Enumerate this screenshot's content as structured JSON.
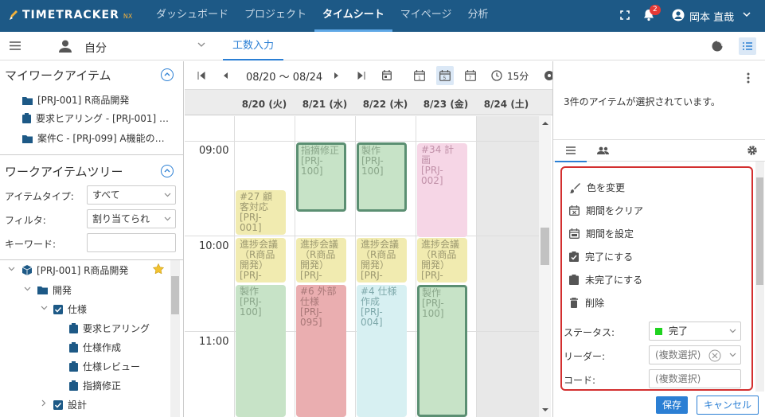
{
  "app": {
    "brand": "TIMETRACKER",
    "brand_suffix": "NX"
  },
  "nav": [
    {
      "label": "ダッシュボード",
      "active": false
    },
    {
      "label": "プロジェクト",
      "active": false
    },
    {
      "label": "タイムシート",
      "active": true
    },
    {
      "label": "マイページ",
      "active": false
    },
    {
      "label": "分析",
      "active": false
    }
  ],
  "header": {
    "notification_count": "2",
    "user_name": "岡本 直哉"
  },
  "subbar": {
    "user_select": "自分",
    "tab_label": "工数入力"
  },
  "left": {
    "my_items_title": "マイワークアイテム",
    "my_items": [
      {
        "label": "[PRJ-001] R商品開発",
        "icon": "folder-icon"
      },
      {
        "label": "要求ヒアリング - [PRJ-001] …",
        "icon": "clipboard-icon"
      },
      {
        "label": "案件C - [PRJ-099] A機能の…",
        "icon": "folder-icon"
      }
    ],
    "tree_title": "ワークアイテムツリー",
    "filters": {
      "type_label": "アイテムタイプ:",
      "type_value": "すべて",
      "filter_label": "フィルタ:",
      "filter_value": "割り当てられ",
      "keyword_label": "キーワード:",
      "keyword_value": ""
    },
    "tree": [
      {
        "label": "[PRJ-001] R商品開発",
        "icon": "cube-icon"
      },
      {
        "label": "開発",
        "icon": "folder-icon"
      },
      {
        "label": "仕様",
        "icon": "checkbox-icon"
      },
      {
        "label": "要求ヒアリング",
        "icon": "clipboard-icon"
      },
      {
        "label": "仕様作成",
        "icon": "clipboard-icon"
      },
      {
        "label": "仕様レビュー",
        "icon": "clipboard-icon"
      },
      {
        "label": "指摘修正",
        "icon": "clipboard-icon"
      },
      {
        "label": "設計",
        "icon": "checkbox-icon"
      }
    ]
  },
  "calendar": {
    "range": "08/20 ～ 08/24",
    "interval": "15分",
    "days": [
      "8/20 (火)",
      "8/21 (水)",
      "8/22 (木)",
      "8/23 (金)",
      "8/24 (土)"
    ],
    "times": [
      "09:00",
      "10:00",
      "11:00"
    ],
    "events": [
      {
        "day": 1,
        "color": "green",
        "selected": true,
        "text": "指摘修正\n[PRJ-\n100]"
      },
      {
        "day": 2,
        "color": "green",
        "selected": true,
        "text": "製作\n[PRJ-\n100]"
      },
      {
        "day": 3,
        "color": "pink",
        "selected": false,
        "text": "#34 計\n画\n[PRJ-\n002]"
      },
      {
        "day": 0,
        "color": "yellow",
        "selected": false,
        "text": "#27 顧\n客対応\n[PRJ-\n001]"
      },
      {
        "day": 0,
        "color": "yellow",
        "selected": false,
        "text": "進捗会議\n（R商品\n開発）\n[PRJ-"
      },
      {
        "day": 1,
        "color": "yellow",
        "selected": false,
        "text": "進捗会議\n（R商品\n開発）\n[PRJ-"
      },
      {
        "day": 2,
        "color": "yellow",
        "selected": false,
        "text": "進捗会議\n（R商品\n開発）\n[PRJ-"
      },
      {
        "day": 3,
        "color": "yellow",
        "selected": false,
        "text": "進捗会議\n（R商品\n開発）\n[PRJ-"
      },
      {
        "day": 0,
        "color": "green",
        "selected": false,
        "text": "製作\n[PRJ-\n100]"
      },
      {
        "day": 1,
        "color": "red",
        "selected": false,
        "text": "#6 外部\n仕様\n[PRJ-\n095]"
      },
      {
        "day": 2,
        "color": "cyan",
        "selected": false,
        "text": "#4 仕様\n作成\n[PRJ-\n004]"
      },
      {
        "day": 3,
        "color": "green",
        "selected": true,
        "text": "製作\n[PRJ-\n100]"
      }
    ]
  },
  "right": {
    "selection_text": "3件のアイテムが選択されています。",
    "actions": [
      {
        "label": "色を変更",
        "icon": "brush-icon"
      },
      {
        "label": "期間をクリア",
        "icon": "calendar-clear-icon"
      },
      {
        "label": "期間を設定",
        "icon": "calendar-set-icon"
      },
      {
        "label": "完了にする",
        "icon": "checked-clipboard-icon"
      },
      {
        "label": "未完了にする",
        "icon": "clipboard-icon"
      },
      {
        "label": "削除",
        "icon": "trash-icon"
      }
    ],
    "status_label": "ステータス:",
    "status_value": "完了",
    "status_color": "#1fd21f",
    "leader_label": "リーダー:",
    "leader_value": "(複数選択)",
    "code_label": "コード:",
    "code_value": "(複数選択)",
    "save_label": "保存",
    "cancel_label": "キャンセル"
  },
  "colors": {
    "header_bg": "#1d5986",
    "accent": "#2b7fd4",
    "highlight_border": "#d32f2f"
  }
}
